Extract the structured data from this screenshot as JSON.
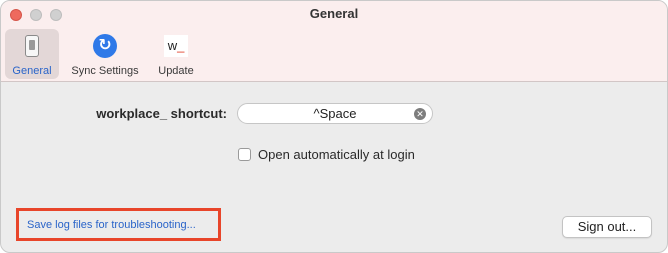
{
  "window": {
    "title": "General"
  },
  "toolbar": {
    "items": [
      {
        "label": "General",
        "icon": "switch-icon",
        "selected": true
      },
      {
        "label": "Sync Settings",
        "icon": "sync-icon",
        "selected": false
      },
      {
        "label": "Update",
        "icon": "update-icon",
        "selected": false
      }
    ]
  },
  "shortcut": {
    "label": "workplace_ shortcut:",
    "value": "^Space"
  },
  "login": {
    "label": "Open automatically at login",
    "checked": false
  },
  "log_link": {
    "label": "Save log files for troubleshooting..."
  },
  "sign_out": {
    "label": "Sign out..."
  },
  "colors": {
    "accent": "#2a64c9",
    "highlight": "#e8452a",
    "titlebar": "#fbeeee"
  }
}
